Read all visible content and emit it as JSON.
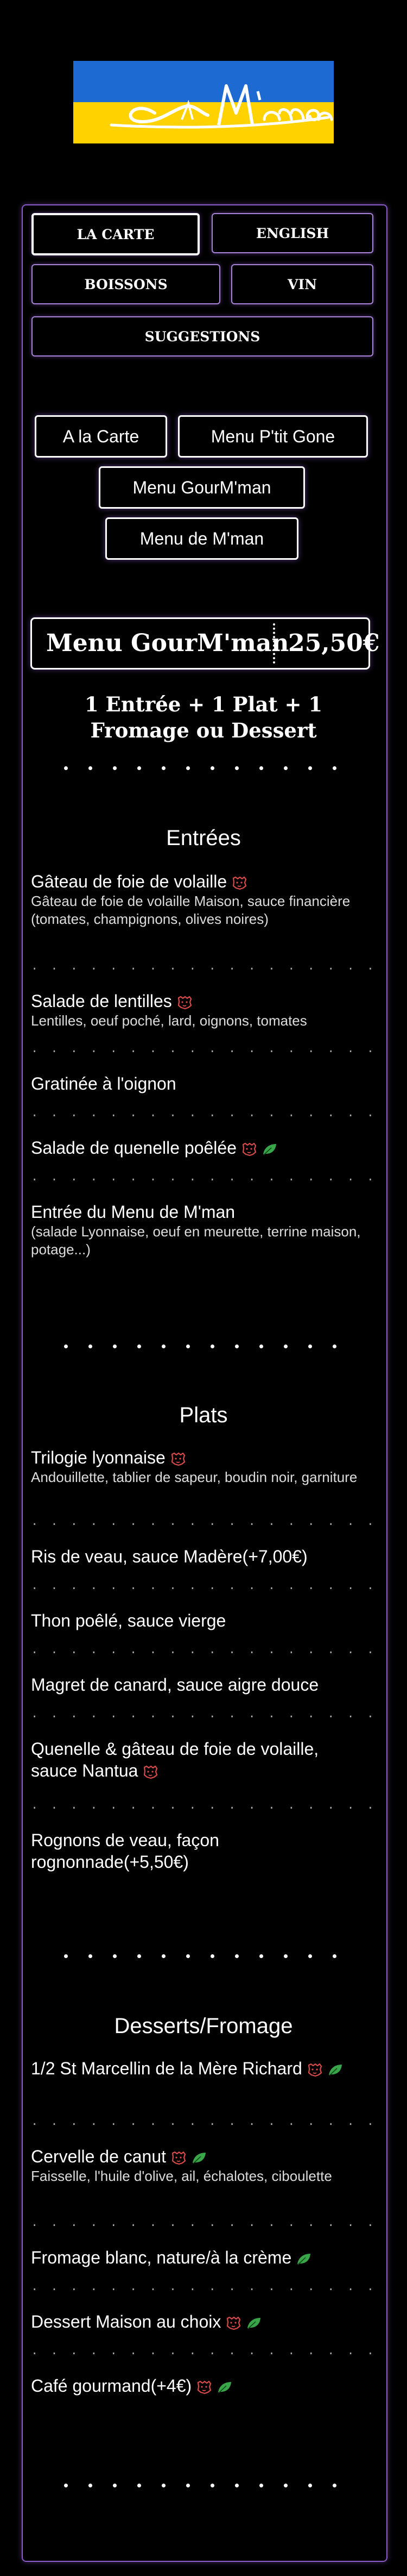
{
  "logo": {
    "text": "Chez M'man",
    "colors": {
      "top": "#1c6ad2",
      "bottom": "#ffd200"
    }
  },
  "tabs": {
    "carte": "LA CARTE",
    "english": "ENGLISH",
    "boissons": "BOISSONS",
    "vin": "VIN",
    "suggestions": "SUGGESTIONS"
  },
  "menus": {
    "a_la_carte": "A la Carte",
    "ptit_gone": "Menu P'tit Gone",
    "gourmman": "Menu GourM'man",
    "de_mman": "Menu de M'man"
  },
  "current_menu": {
    "name": "Menu GourM'man",
    "price": "25,50€",
    "formula": "1 Entrée + 1 Plat + 1 Fromage ou Dessert"
  },
  "separator": ". . . . . . . . . . . . . . . . . .",
  "sections": [
    {
      "title": "Entrées",
      "items": [
        {
          "name": "Gâteau de foie de volaille",
          "desc": "Gâteau de foie de volaille Maison, sauce financière (tomates, champignons, olives noires)",
          "icons": [
            "lion-icon"
          ]
        },
        {
          "name": "Salade de lentilles",
          "desc": "Lentilles, oeuf poché, lard, oignons, tomates",
          "icons": [
            "lion-icon"
          ]
        },
        {
          "name": "Gratinée à l'oignon",
          "desc": "",
          "icons": []
        },
        {
          "name": "Salade de quenelle poêlée",
          "desc": "",
          "icons": [
            "lion-icon",
            "leaf-icon"
          ]
        },
        {
          "name": "Entrée du Menu de M'man",
          "desc": "(salade Lyonnaise, oeuf en meurette, terrine maison, potage...)",
          "icons": []
        }
      ]
    },
    {
      "title": "Plats",
      "items": [
        {
          "name": "Trilogie lyonnaise",
          "desc": "Andouillette, tablier de sapeur, boudin noir, garniture",
          "icons": [
            "lion-icon"
          ]
        },
        {
          "name": "Ris de veau, sauce Madère(+7,00€)",
          "desc": "",
          "icons": []
        },
        {
          "name": "Thon poêlé, sauce vierge",
          "desc": "",
          "icons": []
        },
        {
          "name": "Magret de canard, sauce aigre douce",
          "desc": "",
          "icons": []
        },
        {
          "name": "Quenelle & gâteau de foie de volaille, sauce Nantua",
          "desc": "",
          "icons": [
            "lion-icon"
          ]
        },
        {
          "name": "Rognons de veau, façon rognonnade(+5,50€)",
          "desc": "",
          "icons": []
        }
      ]
    },
    {
      "title": "Desserts/Fromage",
      "items": [
        {
          "name": "1/2 St Marcellin de la Mère Richard",
          "desc": "",
          "icons": [
            "lion-icon",
            "leaf-icon"
          ]
        },
        {
          "name": "Cervelle de canut",
          "desc": "Faisselle, l'huile d'olive, ail, échalotes, ciboulette",
          "icons": [
            "lion-icon",
            "leaf-icon"
          ]
        },
        {
          "name": "Fromage blanc, nature/à la crème",
          "desc": "",
          "icons": [
            "leaf-icon"
          ]
        },
        {
          "name": "Dessert Maison au choix",
          "desc": "",
          "icons": [
            "lion-icon",
            "leaf-icon"
          ]
        },
        {
          "name": "Café gourmand(+4€)",
          "desc": "",
          "icons": [
            "lion-icon",
            "leaf-icon"
          ]
        }
      ]
    }
  ],
  "colors": {
    "accent": "#8a5cc7",
    "lion": "#d94a4a",
    "leaf": "#3aa64a"
  }
}
